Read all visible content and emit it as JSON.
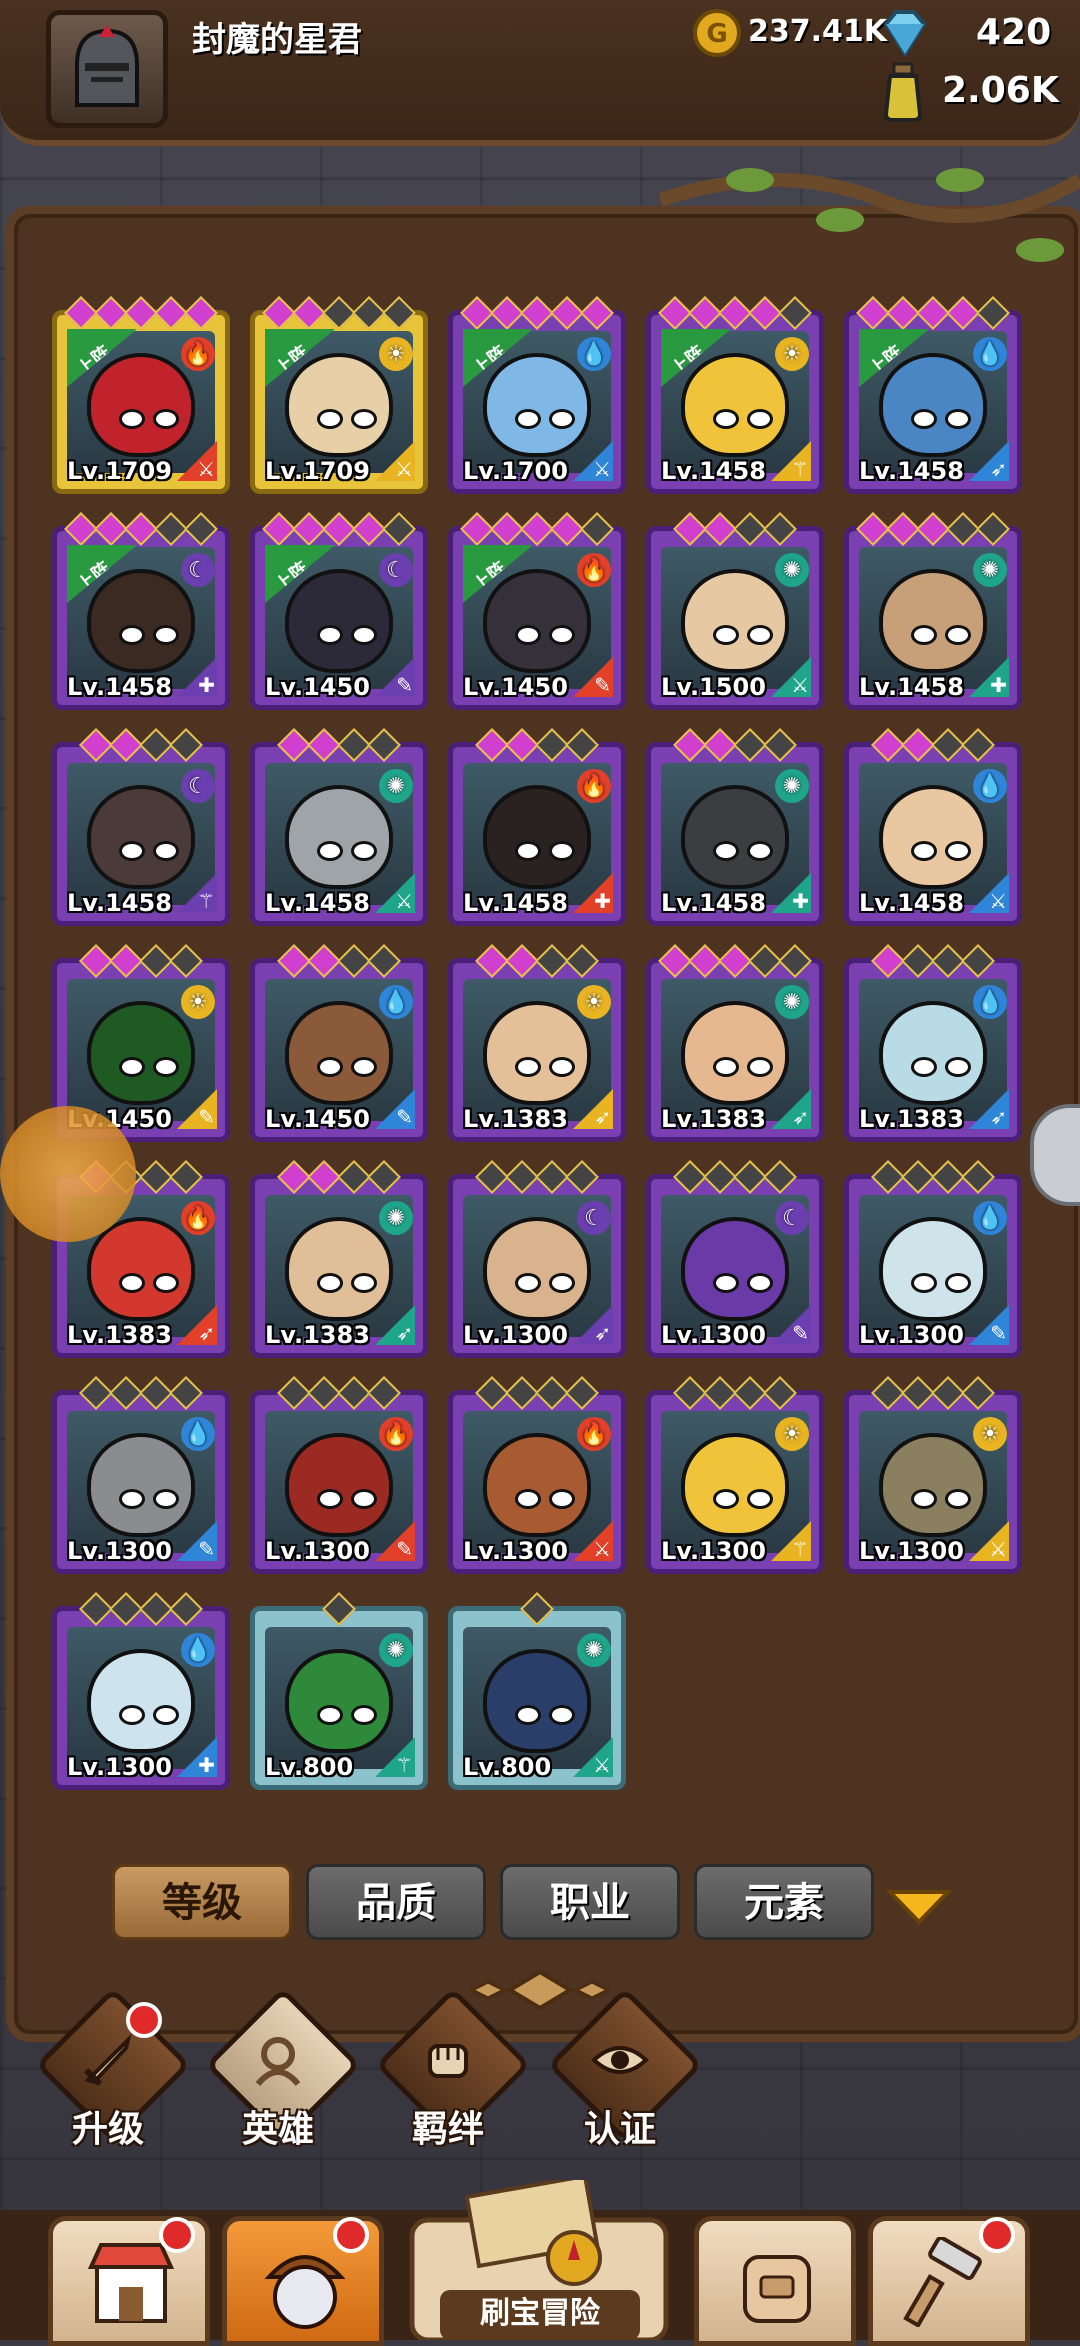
{
  "player": {
    "name": "封魔的星君"
  },
  "resources": {
    "gold": "237.41K",
    "gems": "420",
    "potions": "2.06K"
  },
  "deployed_label": "上阵",
  "heroes": [
    {
      "level": "Lv.1709",
      "rarity": "gold",
      "deployed": true,
      "element": "fire",
      "class": "sword",
      "stars_on": 5,
      "head": "#c0232c"
    },
    {
      "level": "Lv.1709",
      "rarity": "gold",
      "deployed": true,
      "element": "light",
      "class": "sword",
      "stars_on": 2,
      "head": "#e7cfa8"
    },
    {
      "level": "Lv.1700",
      "rarity": "purple",
      "deployed": true,
      "element": "water",
      "class": "sword",
      "stars_on": 5,
      "head": "#7fb8e6"
    },
    {
      "level": "Lv.1458",
      "rarity": "purple",
      "deployed": true,
      "element": "light",
      "class": "staff",
      "stars_on": 4,
      "head": "#f0c33a"
    },
    {
      "level": "Lv.1458",
      "rarity": "purple",
      "deployed": true,
      "element": "water",
      "class": "bow",
      "stars_on": 4,
      "head": "#4b86c4"
    },
    {
      "level": "Lv.1458",
      "rarity": "purple",
      "deployed": true,
      "element": "dark",
      "class": "shield",
      "stars_on": 3,
      "head": "#3a2a22"
    },
    {
      "level": "Lv.1450",
      "rarity": "purple",
      "deployed": true,
      "element": "dark",
      "class": "mic",
      "stars_on": 4,
      "head": "#2c2a38"
    },
    {
      "level": "Lv.1450",
      "rarity": "purple",
      "deployed": true,
      "element": "fire",
      "class": "mic",
      "stars_on": 4,
      "head": "#35303a"
    },
    {
      "level": "Lv.1500",
      "rarity": "purple",
      "deployed": false,
      "element": "wind",
      "class": "sword",
      "stars_on": 2,
      "head": "#e6c9a2"
    },
    {
      "level": "Lv.1458",
      "rarity": "purple",
      "deployed": false,
      "element": "wind",
      "class": "shield",
      "stars_on": 3,
      "head": "#c7a079"
    },
    {
      "level": "Lv.1458",
      "rarity": "purple",
      "deployed": false,
      "element": "dark",
      "class": "staff",
      "stars_on": 2,
      "head": "#4a3b38"
    },
    {
      "level": "Lv.1458",
      "rarity": "purple",
      "deployed": false,
      "element": "wind",
      "class": "sword",
      "stars_on": 2,
      "head": "#9fa4a8"
    },
    {
      "level": "Lv.1458",
      "rarity": "purple",
      "deployed": false,
      "element": "fire",
      "class": "shield",
      "stars_on": 2,
      "head": "#2a2220"
    },
    {
      "level": "Lv.1458",
      "rarity": "purple",
      "deployed": false,
      "element": "wind",
      "class": "shield",
      "stars_on": 2,
      "head": "#3c3d40"
    },
    {
      "level": "Lv.1458",
      "rarity": "purple",
      "deployed": false,
      "element": "water",
      "class": "sword",
      "stars_on": 2,
      "head": "#e9c7a0"
    },
    {
      "level": "Lv.1450",
      "rarity": "purple",
      "deployed": false,
      "element": "light",
      "class": "mic",
      "stars_on": 2,
      "head": "#1f5a22"
    },
    {
      "level": "Lv.1450",
      "rarity": "purple",
      "deployed": false,
      "element": "water",
      "class": "mic",
      "stars_on": 2,
      "head": "#8a5a3a"
    },
    {
      "level": "Lv.1383",
      "rarity": "purple",
      "deployed": false,
      "element": "light",
      "class": "bow",
      "stars_on": 2,
      "head": "#e4c098"
    },
    {
      "level": "Lv.1383",
      "rarity": "purple",
      "deployed": false,
      "element": "wind",
      "class": "bow",
      "stars_on": 3,
      "head": "#e5b88f"
    },
    {
      "level": "Lv.1383",
      "rarity": "purple",
      "deployed": false,
      "element": "water",
      "class": "bow",
      "stars_on": 1,
      "head": "#b8dbe6"
    },
    {
      "level": "Lv.1383",
      "rarity": "purple",
      "deployed": false,
      "element": "fire",
      "class": "bow",
      "stars_on": 1,
      "head": "#d2382e"
    },
    {
      "level": "Lv.1383",
      "rarity": "purple",
      "deployed": false,
      "element": "wind",
      "class": "bow",
      "stars_on": 2,
      "head": "#e0bf98"
    },
    {
      "level": "Lv.1300",
      "rarity": "purple",
      "deployed": false,
      "element": "dark",
      "class": "bow",
      "stars_on": 0,
      "head": "#d8b38e"
    },
    {
      "level": "Lv.1300",
      "rarity": "purple",
      "deployed": false,
      "element": "dark",
      "class": "mic",
      "stars_on": 0,
      "head": "#6a3aa6"
    },
    {
      "level": "Lv.1300",
      "rarity": "purple",
      "deployed": false,
      "element": "water",
      "class": "mic",
      "stars_on": 0,
      "head": "#cfe3ea"
    },
    {
      "level": "Lv.1300",
      "rarity": "purple",
      "deployed": false,
      "element": "water",
      "class": "mic",
      "stars_on": 0,
      "head": "#8a8c90"
    },
    {
      "level": "Lv.1300",
      "rarity": "purple",
      "deployed": false,
      "element": "fire",
      "class": "mic",
      "stars_on": 0,
      "head": "#9a2a22"
    },
    {
      "level": "Lv.1300",
      "rarity": "purple",
      "deployed": false,
      "element": "fire",
      "class": "sword",
      "stars_on": 0,
      "head": "#a85a30"
    },
    {
      "level": "Lv.1300",
      "rarity": "purple",
      "deployed": false,
      "element": "light",
      "class": "staff",
      "stars_on": 0,
      "head": "#f0c33a"
    },
    {
      "level": "Lv.1300",
      "rarity": "purple",
      "deployed": false,
      "element": "light",
      "class": "sword",
      "stars_on": 0,
      "head": "#8a8060"
    },
    {
      "level": "Lv.1300",
      "rarity": "purple",
      "deployed": false,
      "element": "water",
      "class": "shield",
      "stars_on": 0,
      "head": "#cde3ee"
    },
    {
      "level": "Lv.800",
      "rarity": "blue",
      "deployed": false,
      "element": "wind",
      "class": "staff",
      "stars_on": 0,
      "head": "#2e8a3a"
    },
    {
      "level": "Lv.800",
      "rarity": "blue",
      "deployed": false,
      "element": "wind",
      "class": "sword",
      "stars_on": 0,
      "head": "#2a3e6a"
    }
  ],
  "filters": {
    "tabs": [
      "等级",
      "品质",
      "职业",
      "元素"
    ],
    "active": 0
  },
  "subnav": [
    {
      "label": "升级",
      "icon": "sword-icon",
      "badge": true
    },
    {
      "label": "英雄",
      "icon": "hero-icon",
      "badge": false
    },
    {
      "label": "羁绊",
      "icon": "fist-icon",
      "badge": false
    },
    {
      "label": "认证",
      "icon": "eye-icon",
      "badge": false
    }
  ],
  "bottom_nav": {
    "adventure_label": "刷宝冒险"
  },
  "colors": {
    "fire": "#e3402a",
    "water": "#2f86d9",
    "light": "#e8b422",
    "dark": "#6b3fb0",
    "wind": "#1fa58a"
  }
}
